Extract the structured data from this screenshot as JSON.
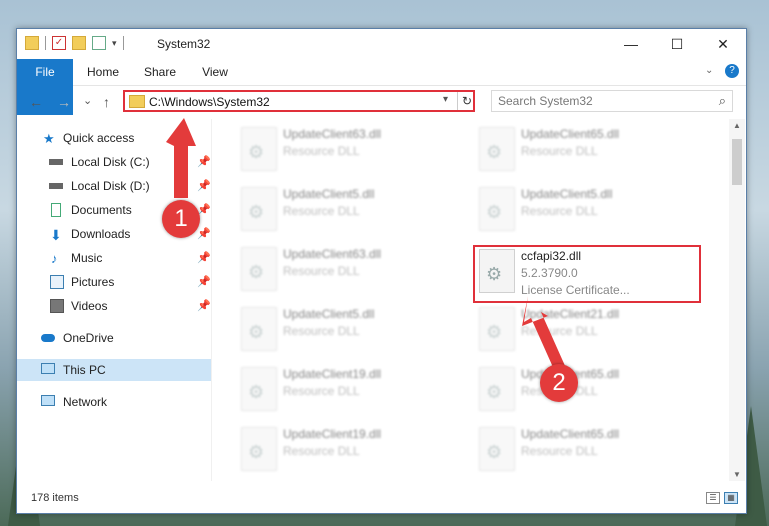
{
  "window": {
    "title": "System32",
    "minimize": "—",
    "maximize": "☐",
    "close": "✕"
  },
  "ribbon": {
    "file": "File",
    "home": "Home",
    "share": "Share",
    "view": "View",
    "help_icon": "help-icon"
  },
  "nav": {
    "back": "←",
    "forward": "→",
    "recent": "⌄",
    "up": "↑"
  },
  "address": {
    "path": "C:\\Windows\\System32",
    "dropdown": "▾",
    "refresh": "↻"
  },
  "search": {
    "placeholder": "Search System32",
    "icon": "⌕"
  },
  "sidebar": {
    "items": [
      {
        "label": "Quick access",
        "pin": ""
      },
      {
        "label": "Local Disk (C:)",
        "pin": "📌"
      },
      {
        "label": "Local Disk (D:)",
        "pin": "📌"
      },
      {
        "label": "Documents",
        "pin": "📌"
      },
      {
        "label": "Downloads",
        "pin": "📌"
      },
      {
        "label": "Music",
        "pin": "📌"
      },
      {
        "label": "Pictures",
        "pin": "📌"
      },
      {
        "label": "Videos",
        "pin": "📌"
      },
      {
        "label": "OneDrive",
        "pin": ""
      },
      {
        "label": "This PC",
        "pin": ""
      },
      {
        "label": "Network",
        "pin": ""
      }
    ]
  },
  "files": {
    "left": [
      {
        "name": "UpdateClient63.dll",
        "desc": "Resource DLL"
      },
      {
        "name": "UpdateClient5.dll",
        "desc": "Resource DLL"
      },
      {
        "name": "UpdateClient63.dll",
        "desc": "Resource DLL"
      },
      {
        "name": "UpdateClient5.dll",
        "desc": "Resource DLL"
      },
      {
        "name": "UpdateClient19.dll",
        "desc": "Resource DLL"
      },
      {
        "name": "UpdateClient19.dll",
        "desc": "Resource DLL"
      }
    ],
    "right": [
      {
        "name": "UpdateClient65.dll",
        "desc": "Resource DLL"
      },
      {
        "name": "UpdateClient5.dll",
        "desc": "Resource DLL"
      },
      {
        "name": "ccfapi32.dll",
        "desc": "5.2.3790.0",
        "extra": "License Certificate..."
      },
      {
        "name": "UpdateClient21.dll",
        "desc": "Resource DLL"
      },
      {
        "name": "UpdateClient65.dll",
        "desc": "Resource DLL"
      },
      {
        "name": "UpdateClient65.dll",
        "desc": "Resource DLL"
      }
    ]
  },
  "status": {
    "count": "178 items"
  },
  "callouts": {
    "one": "1",
    "two": "2"
  },
  "colors": {
    "accent": "#1979ca",
    "highlight": "#e0303a",
    "callout": "#e33b3b",
    "selection": "#cce4f7"
  }
}
